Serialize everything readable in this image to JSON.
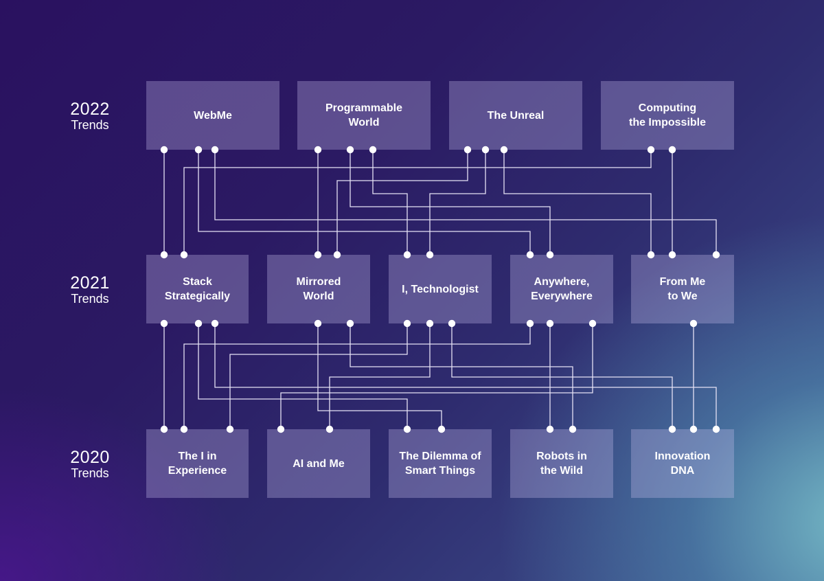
{
  "rows": [
    {
      "year": "2022",
      "label": "Trends"
    },
    {
      "year": "2021",
      "label": "Trends"
    },
    {
      "year": "2020",
      "label": "Trends"
    }
  ],
  "trends_2022": [
    "WebMe",
    "Programmable\nWorld",
    "The Unreal",
    "Computing\nthe Impossible"
  ],
  "trends_2021": [
    "Stack\nStrategically",
    "Mirrored\nWorld",
    "I, Technologist",
    "Anywhere,\nEverywhere",
    "From Me\nto We"
  ],
  "trends_2020": [
    "The I in\nExperience",
    "AI and Me",
    "The Dilemma of\nSmart Things",
    "Robots in\nthe Wild",
    "Innovation\nDNA"
  ],
  "colors": {
    "line": "#e6e2f5",
    "dot": "#ffffff"
  },
  "connections_2022_to_2021": [
    {
      "from": "WebMe",
      "to": "Stack Strategically"
    },
    {
      "from": "WebMe",
      "to": "Anywhere, Everywhere"
    },
    {
      "from": "WebMe",
      "to": "From Me to We"
    },
    {
      "from": "Programmable World",
      "to": "Mirrored World"
    },
    {
      "from": "Programmable World",
      "to": "Anywhere, Everywhere"
    },
    {
      "from": "Programmable World",
      "to": "I, Technologist"
    },
    {
      "from": "The Unreal",
      "to": "Mirrored World"
    },
    {
      "from": "The Unreal",
      "to": "I, Technologist"
    },
    {
      "from": "The Unreal",
      "to": "From Me to We"
    },
    {
      "from": "Computing the Impossible",
      "to": "Stack Strategically"
    },
    {
      "from": "Computing the Impossible",
      "to": "From Me to We"
    }
  ],
  "connections_2021_to_2020": [
    {
      "from": "Stack Strategically",
      "to": "The I in Experience"
    },
    {
      "from": "Stack Strategically",
      "to": "The Dilemma of Smart Things"
    },
    {
      "from": "Stack Strategically",
      "to": "Innovation DNA"
    },
    {
      "from": "Mirrored World",
      "to": "The Dilemma of Smart Things"
    },
    {
      "from": "Mirrored World",
      "to": "Robots in the Wild"
    },
    {
      "from": "I, Technologist",
      "to": "The I in Experience"
    },
    {
      "from": "I, Technologist",
      "to": "AI and Me"
    },
    {
      "from": "I, Technologist",
      "to": "Innovation DNA"
    },
    {
      "from": "Anywhere, Everywhere",
      "to": "The I in Experience"
    },
    {
      "from": "Anywhere, Everywhere",
      "to": "Robots in the Wild"
    },
    {
      "from": "Anywhere, Everywhere",
      "to": "AI and Me"
    },
    {
      "from": "From Me to We",
      "to": "Innovation DNA"
    }
  ]
}
